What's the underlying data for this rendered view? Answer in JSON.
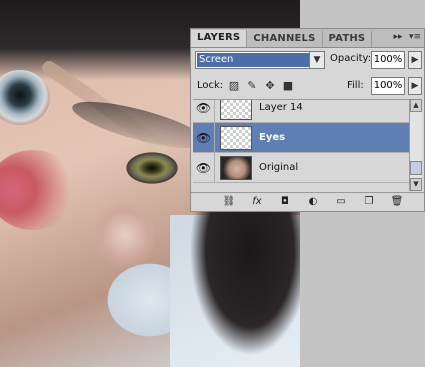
{
  "panel": {
    "tabs": [
      {
        "label": "LAYERS",
        "active": true
      },
      {
        "label": "CHANNELS",
        "active": false
      },
      {
        "label": "PATHS",
        "active": false
      }
    ],
    "controls": {
      "expand_icon": "double-chevron-right-icon",
      "menu_icon": "panel-menu-icon"
    },
    "blend_mode": "Screen",
    "opacity_label": "Opacity:",
    "opacity_value": "100%",
    "lock_label": "Lock:",
    "lock_icons": [
      "lock-transparent-icon",
      "lock-brush-icon",
      "lock-move-icon",
      "lock-all-icon"
    ],
    "fill_label": "Fill:",
    "fill_value": "100%",
    "layers": [
      {
        "name": "Layer 14",
        "visible": true,
        "selected": false,
        "thumb": "transparent"
      },
      {
        "name": "Eyes",
        "visible": true,
        "selected": true,
        "thumb": "transparent"
      },
      {
        "name": "Original",
        "visible": true,
        "selected": false,
        "thumb": "photo"
      }
    ],
    "bottom_icons": [
      "link-icon",
      "fx-icon",
      "mask-icon",
      "adjustment-icon",
      "folder-icon",
      "new-layer-icon",
      "trash-icon"
    ]
  },
  "colors": {
    "selected_row": "#5f7fb3",
    "blend_highlight": "#4a6ea9"
  }
}
